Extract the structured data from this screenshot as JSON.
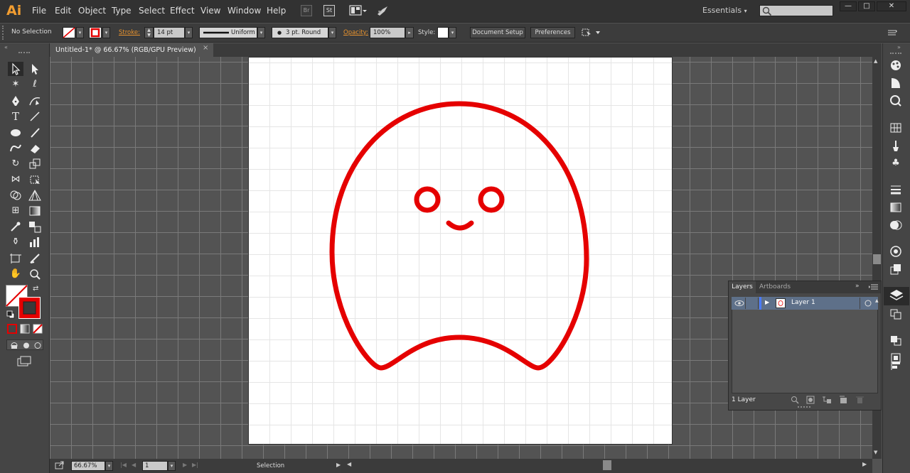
{
  "app": {
    "logo": "Ai"
  },
  "menus": [
    "File",
    "Edit",
    "Object",
    "Type",
    "Select",
    "Effect",
    "View",
    "Window",
    "Help"
  ],
  "menu_icons": {
    "bridge": "Br",
    "stock": "St"
  },
  "workspace": {
    "label": "Essentials"
  },
  "window_controls": {
    "minimize": "—",
    "maximize": "□",
    "close": "✕"
  },
  "control_bar": {
    "selection_label": "No Selection",
    "stroke_label": "Stroke:",
    "stroke_weight": "14 pt",
    "profile": "Uniform",
    "brush": "3 pt. Round",
    "opacity_label": "Opacity:",
    "opacity": "100%",
    "style_label": "Style:",
    "document_setup": "Document Setup",
    "preferences": "Preferences"
  },
  "document": {
    "tab_title": "Untitled-1* @ 66.67% (RGB/GPU Preview)",
    "close": "×"
  },
  "status_bar": {
    "zoom": "66.67%",
    "artboard": "1",
    "tool": "Selection"
  },
  "layers_panel": {
    "tabs": [
      "Layers",
      "Artboards"
    ],
    "layers": [
      {
        "name": "Layer 1"
      }
    ],
    "count_label": "1 Layer"
  },
  "colors": {
    "stroke": "#e50000",
    "accent": "#e8932e",
    "layer_select": "#5e7089"
  }
}
